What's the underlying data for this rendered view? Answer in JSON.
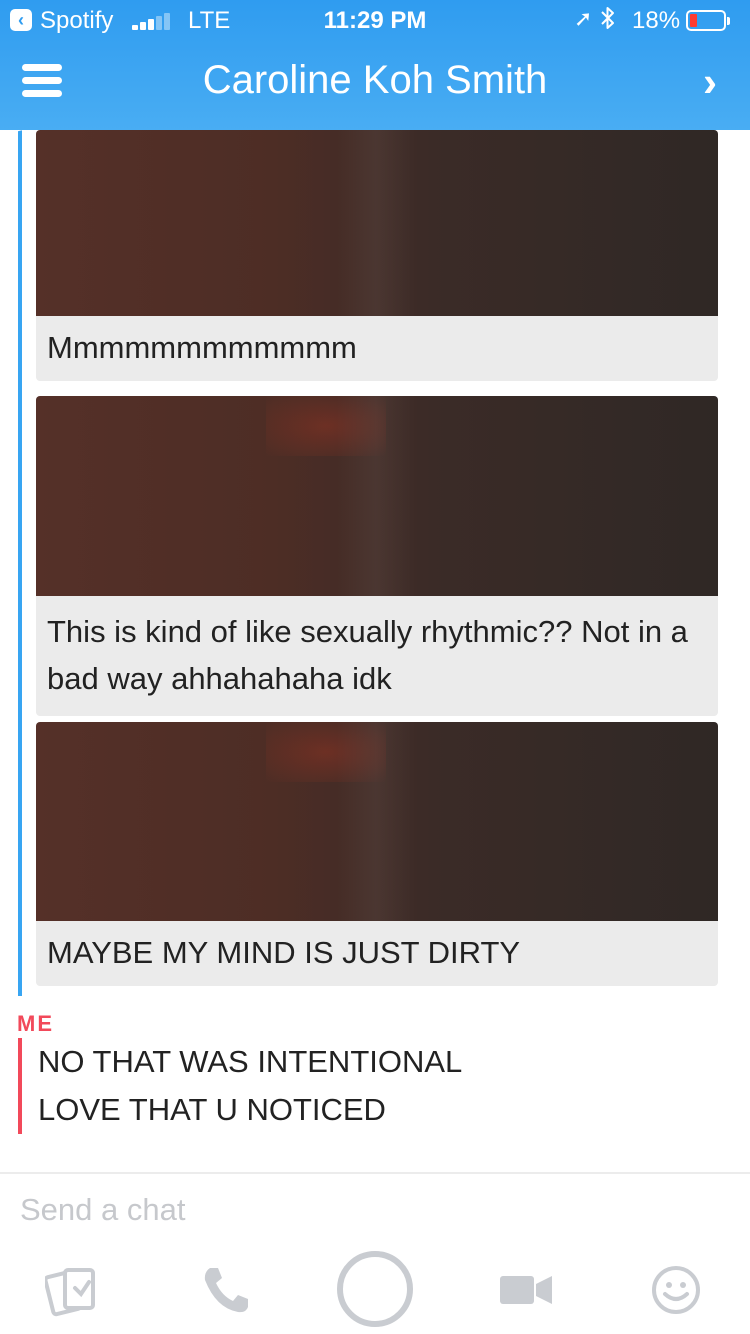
{
  "status_bar": {
    "app": "Spotify",
    "carrier": "LTE",
    "time": "11:29 PM",
    "battery": "18%"
  },
  "header": {
    "title": "Caroline Koh Smith"
  },
  "messages": {
    "them": [
      {
        "caption": "Mmmmmmmmmmmm"
      },
      {
        "caption": "This is kind of like sexually rhythmic?? Not in a bad way ahhahahaha idk"
      },
      {
        "caption": "MAYBE MY MIND IS JUST DIRTY"
      }
    ],
    "me": {
      "label": "ME",
      "lines": [
        "NO THAT WAS INTENTIONAL",
        "LOVE THAT U NOTICED"
      ]
    }
  },
  "compose": {
    "placeholder": "Send a chat"
  },
  "toolbar": {
    "icons": [
      "memories-icon",
      "phone-icon",
      "capture-icon",
      "video-icon",
      "emoji-icon"
    ]
  },
  "colors": {
    "header": "#2f9cf0",
    "their_bar": "#38a5f2",
    "my_accent": "#f2495a",
    "icon_gray": "#c9ccd1"
  }
}
